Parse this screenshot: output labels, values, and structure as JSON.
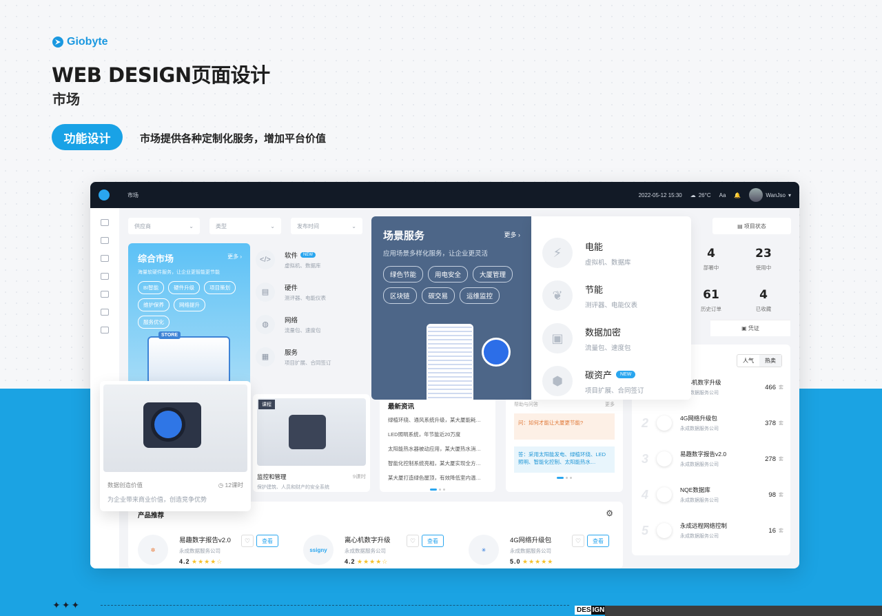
{
  "header": {
    "brand": "Giobyte",
    "title": "WEB DESIGN页面设计",
    "subtitle": "市场",
    "pill": "功能设计",
    "tagline": "市场提供各种定制化服务，增加平台价值"
  },
  "topbar": {
    "page": "市场",
    "datetime": "2022-05-12 15:30",
    "weather": "26°C",
    "font": "Aa",
    "user": "WanJso"
  },
  "filters": [
    "供应商",
    "类型",
    "发布时间"
  ],
  "market": {
    "title": "综合市场",
    "more": "更多",
    "desc": "海量软硬件服务，让企业更智能更节能",
    "tags": [
      "BI智能",
      "硬件升级",
      "项目策划",
      "维护保养",
      "网络提升",
      "服务优化"
    ]
  },
  "categories": [
    {
      "name": "软件",
      "sub": "虚拟机、数据库",
      "new": "NEW"
    },
    {
      "name": "硬件",
      "sub": "测评器、电能仪表",
      "new": ""
    },
    {
      "name": "网络",
      "sub": "流量包、速度包",
      "new": ""
    },
    {
      "name": "服务",
      "sub": "项目扩展、合同签订",
      "new": ""
    }
  ],
  "scene": {
    "title": "场景服务",
    "more": "更多",
    "desc": "应用场景多样化服务，让企业更灵活",
    "tags": [
      "绿色节能",
      "用电安全",
      "大厦管理",
      "区块链",
      "碳交易",
      "运维监控"
    ]
  },
  "services": [
    {
      "name": "电能",
      "sub": "虚拟机、数据库",
      "new": ""
    },
    {
      "name": "节能",
      "sub": "测评器、电能仪表",
      "new": ""
    },
    {
      "name": "数据加密",
      "sub": "流量包、速度包",
      "new": ""
    },
    {
      "name": "碳资产",
      "sub": "项目扩展、合同签订",
      "new": "NEW"
    }
  ],
  "stats": {
    "tab": "项目状态",
    "items": [
      {
        "value": "4",
        "label": "部署中"
      },
      {
        "value": "23",
        "label": "使用中"
      },
      {
        "value": "61",
        "label": "历史订单"
      },
      {
        "value": "4",
        "label": "已收藏"
      }
    ],
    "voucher": "凭证"
  },
  "ranking": {
    "tabs": [
      "人气",
      "热卖"
    ],
    "rows": [
      {
        "rank": "1",
        "name": "离心机数字升级",
        "company": "永成数据服务公司",
        "value": "466",
        "unit": "套"
      },
      {
        "rank": "2",
        "name": "4G网络升级包",
        "company": "永成数据服务公司",
        "value": "378",
        "unit": "套"
      },
      {
        "rank": "3",
        "name": "易趣数字报告v2.0",
        "company": "永成数据服务公司",
        "value": "278",
        "unit": "套"
      },
      {
        "rank": "4",
        "name": "NQE数据库",
        "company": "永成数据服务公司",
        "value": "98",
        "unit": "套"
      },
      {
        "rank": "5",
        "name": "永成远程网络控制",
        "company": "永成数据服务公司",
        "value": "16",
        "unit": "套"
      }
    ]
  },
  "float_course": {
    "title": "数据创造价值",
    "lessons": "12课时",
    "desc": "为企业带来商业价值，创造竞争优势"
  },
  "course": {
    "badge": "课程",
    "title": "监控和管理",
    "lessons": "9课时",
    "desc": "保护建筑、人员和财产的安全系统"
  },
  "news": {
    "title": "最新资讯",
    "items": [
      "绿植环绕、通风系统升级，某大厦能耗…",
      "LED照明系统，年节能近20万度",
      "太阳能热水器被动应用，某大厦热水消…",
      "智能化控制系统亮相，某大厦实现全方…",
      "某大厦打造绿色屋顶，有效降低室内温…"
    ]
  },
  "qa": {
    "title": "帮助与问答",
    "more": "更多",
    "question": "问：如何才能让大厦更节能?",
    "answer": "答：采用太阳能发电、绿植环绕、LED照明、智能化控制、太阳能热水…"
  },
  "products": {
    "title": "产品推荐",
    "view": "查看",
    "items": [
      {
        "name": "易趣数字报告v2.0",
        "company": "永成数据服务公司",
        "score": "4.2"
      },
      {
        "name": "离心机数字升级",
        "company": "永成数据服务公司",
        "score": "4.2",
        "logo": "ssigny"
      },
      {
        "name": "4G网络升级包",
        "company": "永成数据服务公司",
        "score": "5.0"
      }
    ]
  },
  "footer": {
    "design": "DES",
    "design2": "IGN"
  }
}
